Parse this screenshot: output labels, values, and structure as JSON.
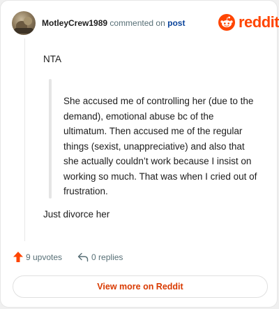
{
  "comment": {
    "username": "MotleyCrew1989",
    "action_text": "commented on",
    "post_link": "post",
    "body_first": "NTA",
    "quote": "She accused me of controlling her (due to the demand), emotional abuse bc of the ultimatum. Then accused me of the regular things (sexist, unappreciative) and also that she actually couldn’t work because I insist on working so much. That was when I cried out of frustration.",
    "body_last": "Just divorce her"
  },
  "brand": {
    "name": "reddit",
    "color": "#ff4500"
  },
  "actions": {
    "upvotes": "9 upvotes",
    "replies": "0 replies"
  },
  "footer": {
    "view_more": "View more on Reddit"
  },
  "icons": {
    "avatar": "user-avatar",
    "logo": "reddit-snoo-icon",
    "upvote": "upvote-arrow-icon",
    "reply": "reply-arrow-icon"
  }
}
